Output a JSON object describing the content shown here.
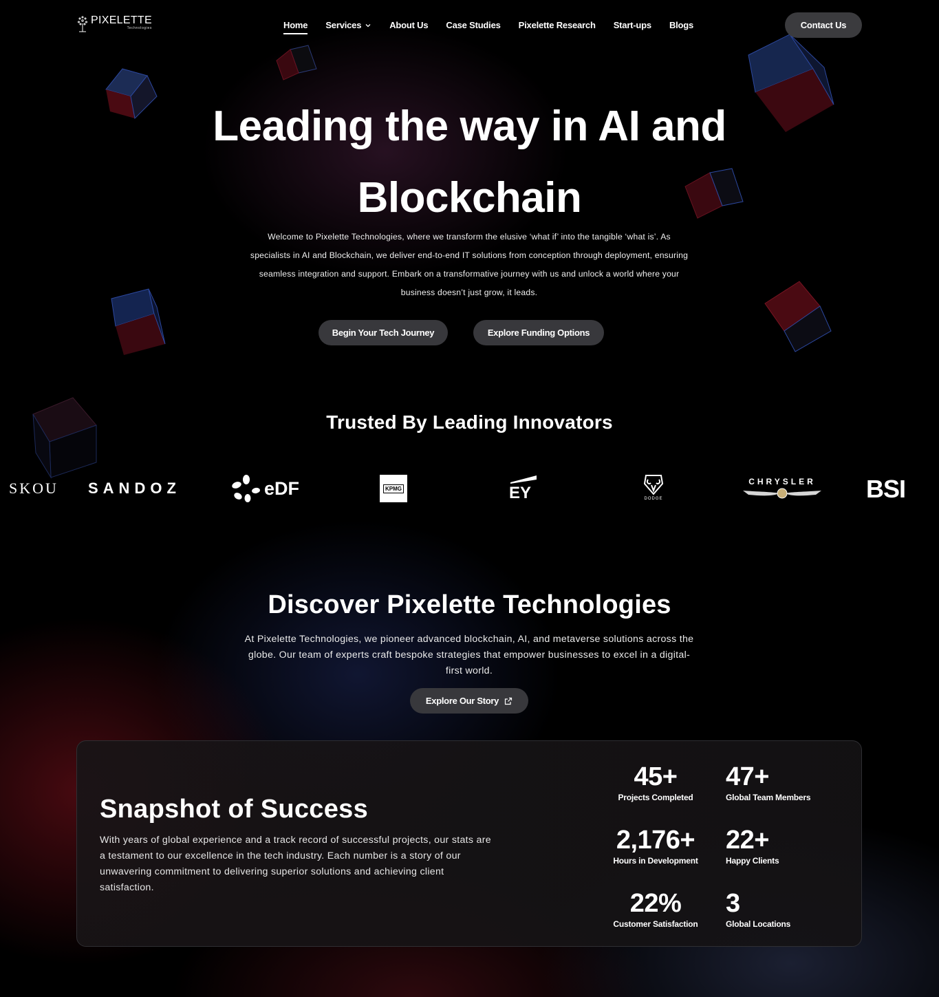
{
  "brand": {
    "name": "PIXELETTE",
    "sub": "Technologies"
  },
  "nav": {
    "items": [
      {
        "label": "Home",
        "active": true
      },
      {
        "label": "Services",
        "dropdown": true
      },
      {
        "label": "About Us"
      },
      {
        "label": "Case Studies"
      },
      {
        "label": "Pixelette Research"
      },
      {
        "label": "Start-ups"
      },
      {
        "label": "Blogs"
      }
    ],
    "contact_label": "Contact Us"
  },
  "hero": {
    "title_line1": "Leading the way in AI and",
    "title_line2": "Blockchain",
    "description": "Welcome to Pixelette Technologies, where we transform the elusive ‘what if’ into the tangible ‘what is’. As specialists in AI and Blockchain, we deliver end-to-end IT solutions from conception through deployment, ensuring seamless integration and support. Embark on a transformative journey with us and unlock a world where your business doesn’t just grow, it leads.",
    "primary_cta": "Begin Your Tech Journey",
    "secondary_cta": "Explore Funding Options"
  },
  "trusted": {
    "title": "Trusted By Leading Innovators",
    "logos": {
      "skou": "SKOU",
      "sandoz": "SANDOZ",
      "edf": "eDF",
      "kpmg": "KPMG",
      "ey": "EY",
      "dodge": "DODGE",
      "chrysler": "CHRYSLER",
      "bsi": "BSI"
    }
  },
  "discover": {
    "title": "Discover Pixelette Technologies",
    "description": "At Pixelette Technologies, we pioneer advanced blockchain, AI, and metaverse solutions across the globe. Our team of experts craft bespoke strategies that empower businesses to excel in a digital-first world.",
    "cta": "Explore Our Story",
    "cta_icon": "external-link-icon"
  },
  "snapshot": {
    "title": "Snapshot of Success",
    "description": "With years of global experience and a track record of successful projects, our stats are a testament to our excellence in the tech industry. Each number is a story of our unwavering commitment to delivering superior solutions and achieving client satisfaction.",
    "stats": [
      {
        "value": "45+",
        "label": "Projects Completed"
      },
      {
        "value": "47+",
        "label": "Global Team Members"
      },
      {
        "value": "2,176+",
        "label": "Hours in Development"
      },
      {
        "value": "22+",
        "label": "Happy Clients"
      },
      {
        "value": "22%",
        "label": "Customer Satisfaction"
      },
      {
        "value": "3",
        "label": "Global Locations"
      }
    ]
  },
  "colors": {
    "background": "#000000",
    "button": "#38383c",
    "card": "#181416",
    "cube_red": "#5a0c14",
    "cube_blue": "#1c2e5a"
  }
}
